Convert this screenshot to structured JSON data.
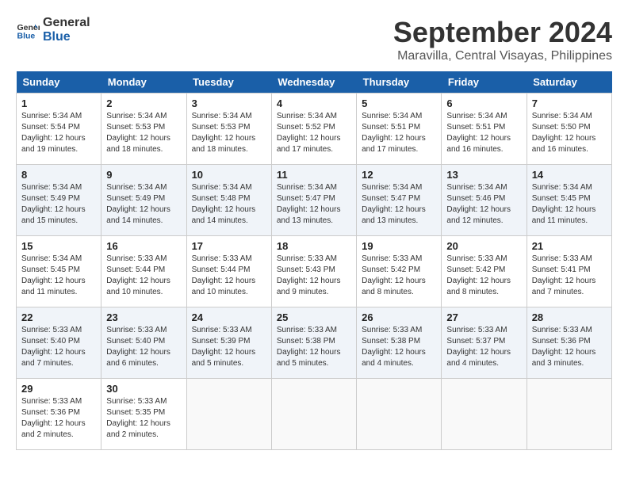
{
  "header": {
    "logo_line1": "General",
    "logo_line2": "Blue",
    "month": "September 2024",
    "location": "Maravilla, Central Visayas, Philippines"
  },
  "weekdays": [
    "Sunday",
    "Monday",
    "Tuesday",
    "Wednesday",
    "Thursday",
    "Friday",
    "Saturday"
  ],
  "weeks": [
    [
      {
        "day": "1",
        "sunrise": "5:34 AM",
        "sunset": "5:54 PM",
        "daylight": "12 hours and 19 minutes."
      },
      {
        "day": "2",
        "sunrise": "5:34 AM",
        "sunset": "5:53 PM",
        "daylight": "12 hours and 18 minutes."
      },
      {
        "day": "3",
        "sunrise": "5:34 AM",
        "sunset": "5:53 PM",
        "daylight": "12 hours and 18 minutes."
      },
      {
        "day": "4",
        "sunrise": "5:34 AM",
        "sunset": "5:52 PM",
        "daylight": "12 hours and 17 minutes."
      },
      {
        "day": "5",
        "sunrise": "5:34 AM",
        "sunset": "5:51 PM",
        "daylight": "12 hours and 17 minutes."
      },
      {
        "day": "6",
        "sunrise": "5:34 AM",
        "sunset": "5:51 PM",
        "daylight": "12 hours and 16 minutes."
      },
      {
        "day": "7",
        "sunrise": "5:34 AM",
        "sunset": "5:50 PM",
        "daylight": "12 hours and 16 minutes."
      }
    ],
    [
      {
        "day": "8",
        "sunrise": "5:34 AM",
        "sunset": "5:49 PM",
        "daylight": "12 hours and 15 minutes."
      },
      {
        "day": "9",
        "sunrise": "5:34 AM",
        "sunset": "5:49 PM",
        "daylight": "12 hours and 14 minutes."
      },
      {
        "day": "10",
        "sunrise": "5:34 AM",
        "sunset": "5:48 PM",
        "daylight": "12 hours and 14 minutes."
      },
      {
        "day": "11",
        "sunrise": "5:34 AM",
        "sunset": "5:47 PM",
        "daylight": "12 hours and 13 minutes."
      },
      {
        "day": "12",
        "sunrise": "5:34 AM",
        "sunset": "5:47 PM",
        "daylight": "12 hours and 13 minutes."
      },
      {
        "day": "13",
        "sunrise": "5:34 AM",
        "sunset": "5:46 PM",
        "daylight": "12 hours and 12 minutes."
      },
      {
        "day": "14",
        "sunrise": "5:34 AM",
        "sunset": "5:45 PM",
        "daylight": "12 hours and 11 minutes."
      }
    ],
    [
      {
        "day": "15",
        "sunrise": "5:34 AM",
        "sunset": "5:45 PM",
        "daylight": "12 hours and 11 minutes."
      },
      {
        "day": "16",
        "sunrise": "5:33 AM",
        "sunset": "5:44 PM",
        "daylight": "12 hours and 10 minutes."
      },
      {
        "day": "17",
        "sunrise": "5:33 AM",
        "sunset": "5:44 PM",
        "daylight": "12 hours and 10 minutes."
      },
      {
        "day": "18",
        "sunrise": "5:33 AM",
        "sunset": "5:43 PM",
        "daylight": "12 hours and 9 minutes."
      },
      {
        "day": "19",
        "sunrise": "5:33 AM",
        "sunset": "5:42 PM",
        "daylight": "12 hours and 8 minutes."
      },
      {
        "day": "20",
        "sunrise": "5:33 AM",
        "sunset": "5:42 PM",
        "daylight": "12 hours and 8 minutes."
      },
      {
        "day": "21",
        "sunrise": "5:33 AM",
        "sunset": "5:41 PM",
        "daylight": "12 hours and 7 minutes."
      }
    ],
    [
      {
        "day": "22",
        "sunrise": "5:33 AM",
        "sunset": "5:40 PM",
        "daylight": "12 hours and 7 minutes."
      },
      {
        "day": "23",
        "sunrise": "5:33 AM",
        "sunset": "5:40 PM",
        "daylight": "12 hours and 6 minutes."
      },
      {
        "day": "24",
        "sunrise": "5:33 AM",
        "sunset": "5:39 PM",
        "daylight": "12 hours and 5 minutes."
      },
      {
        "day": "25",
        "sunrise": "5:33 AM",
        "sunset": "5:38 PM",
        "daylight": "12 hours and 5 minutes."
      },
      {
        "day": "26",
        "sunrise": "5:33 AM",
        "sunset": "5:38 PM",
        "daylight": "12 hours and 4 minutes."
      },
      {
        "day": "27",
        "sunrise": "5:33 AM",
        "sunset": "5:37 PM",
        "daylight": "12 hours and 4 minutes."
      },
      {
        "day": "28",
        "sunrise": "5:33 AM",
        "sunset": "5:36 PM",
        "daylight": "12 hours and 3 minutes."
      }
    ],
    [
      {
        "day": "29",
        "sunrise": "5:33 AM",
        "sunset": "5:36 PM",
        "daylight": "12 hours and 2 minutes."
      },
      {
        "day": "30",
        "sunrise": "5:33 AM",
        "sunset": "5:35 PM",
        "daylight": "12 hours and 2 minutes."
      },
      null,
      null,
      null,
      null,
      null
    ]
  ],
  "labels": {
    "sunrise": "Sunrise:",
    "sunset": "Sunset:",
    "daylight": "Daylight:"
  }
}
